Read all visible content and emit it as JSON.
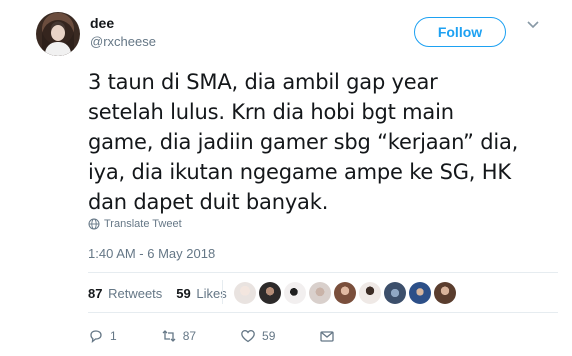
{
  "user": {
    "display_name": "dee",
    "handle": "@rxcheese"
  },
  "follow_button": {
    "label": "Follow"
  },
  "tweet": {
    "lines": [
      "3 taun di SMA, dia ambil gap year",
      "setelah lulus. Krn dia hobi bgt main",
      "game, dia jadiin gamer sbg “kerjaan” dia,",
      "iya, dia ikutan ngegame ampe ke SG, HK",
      "dan dapet duit banyak."
    ],
    "translate_label": "Translate Tweet",
    "timestamp": "1:40 AM - 6 May 2018"
  },
  "stats": {
    "retweets_count": "87",
    "retweets_label": "Retweets",
    "likes_count": "59",
    "likes_label": "Likes"
  },
  "likers": [
    {
      "icon": "avatar-1",
      "color": "#e9e3e0"
    },
    {
      "icon": "avatar-2",
      "color": "#2d2a2a"
    },
    {
      "icon": "avatar-3",
      "color": "#f2efef"
    },
    {
      "icon": "avatar-4",
      "color": "#d9d0cc"
    },
    {
      "icon": "avatar-5",
      "color": "#7a4f3c"
    },
    {
      "icon": "avatar-6",
      "color": "#efe9e6"
    },
    {
      "icon": "avatar-7",
      "color": "#3c4f6b"
    },
    {
      "icon": "avatar-8",
      "color": "#2c4f88"
    },
    {
      "icon": "avatar-9",
      "color": "#5a3d2e"
    }
  ],
  "actions": {
    "reply_count": "1",
    "retweet_count": "87",
    "like_count": "59"
  },
  "colors": {
    "accent": "#1da1f2",
    "text": "#14171a",
    "secondary": "#657786",
    "divider": "#e6ecf0"
  }
}
